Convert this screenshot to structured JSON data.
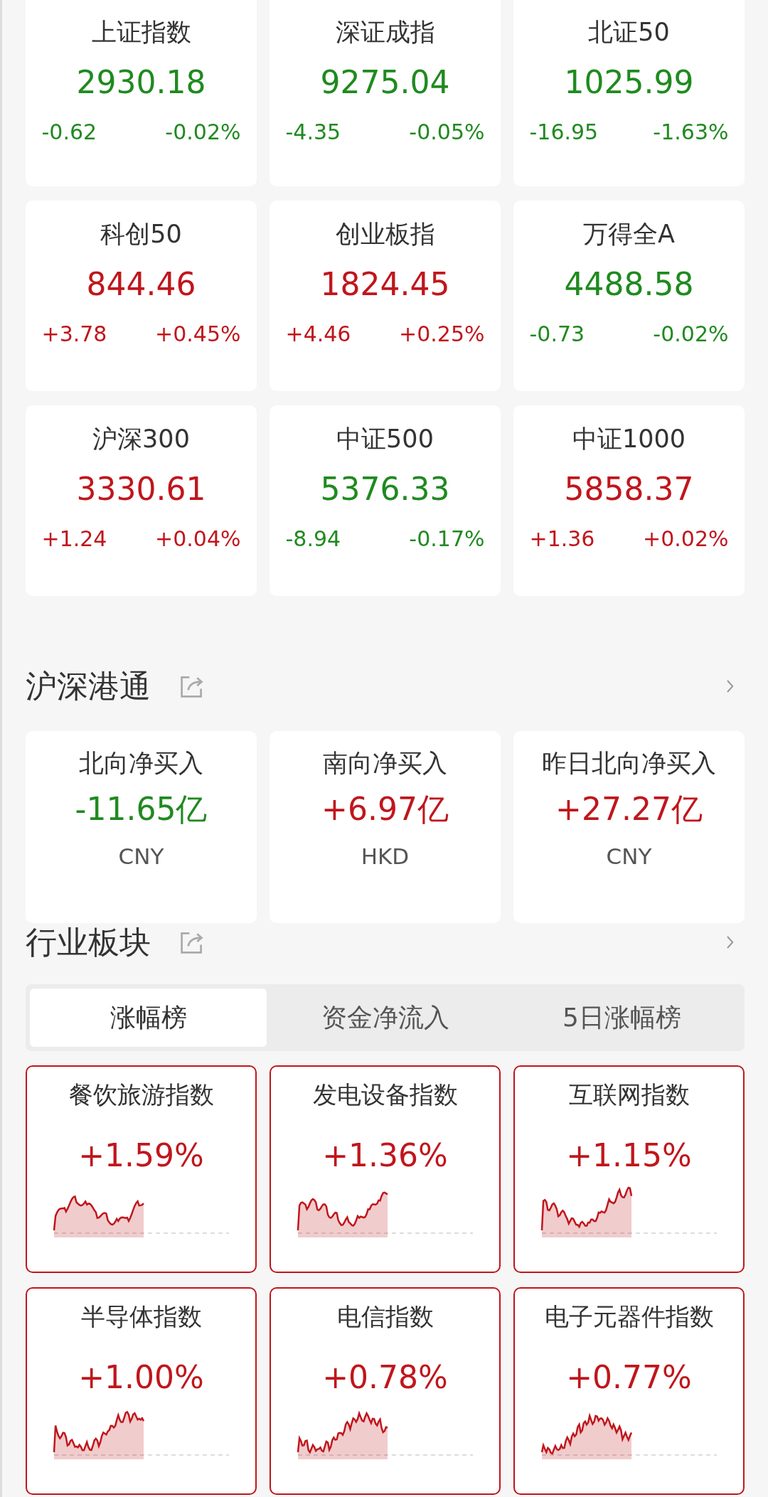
{
  "indices": [
    {
      "name": "上证指数",
      "value": "2930.18",
      "change": "-0.62",
      "percent": "-0.02%",
      "color": "#1f8a1f"
    },
    {
      "name": "深证成指",
      "value": "9275.04",
      "change": "-4.35",
      "percent": "-0.05%",
      "color": "#1f8a1f"
    },
    {
      "name": "北证50",
      "value": "1025.99",
      "change": "-16.95",
      "percent": "-1.63%",
      "color": "#1f8a1f"
    },
    {
      "name": "科创50",
      "value": "844.46",
      "change": "+3.78",
      "percent": "+0.45%",
      "color": "#c0161c"
    },
    {
      "name": "创业板指",
      "value": "1824.45",
      "change": "+4.46",
      "percent": "+0.25%",
      "color": "#c0161c"
    },
    {
      "name": "万得全A",
      "value": "4488.58",
      "change": "-0.73",
      "percent": "-0.02%",
      "color": "#1f8a1f"
    },
    {
      "name": "沪深300",
      "value": "3330.61",
      "change": "+1.24",
      "percent": "+0.04%",
      "color": "#c0161c"
    },
    {
      "name": "中证500",
      "value": "5376.33",
      "change": "-8.94",
      "percent": "-0.17%",
      "color": "#1f8a1f"
    },
    {
      "name": "中证1000",
      "value": "5858.37",
      "change": "+1.36",
      "percent": "+0.02%",
      "color": "#c0161c"
    }
  ],
  "connect": {
    "title": "沪深港通",
    "items": [
      {
        "name": "北向净买入",
        "value": "-11.65亿",
        "currency": "CNY",
        "color": "#1f8a1f"
      },
      {
        "name": "南向净买入",
        "value": "+6.97亿",
        "currency": "HKD",
        "color": "#c0161c"
      },
      {
        "name": "昨日北向净买入",
        "value": "+27.27亿",
        "currency": "CNY",
        "color": "#c0161c"
      }
    ]
  },
  "sectors": {
    "title": "行业板块",
    "tabs": [
      {
        "label": "涨幅榜",
        "selected": true
      },
      {
        "label": "资金净流入",
        "selected": false
      },
      {
        "label": "5日涨幅榜",
        "selected": false
      }
    ],
    "items": [
      {
        "name": "餐饮旅游指数",
        "percent": "+1.59%",
        "color": "#c0161c"
      },
      {
        "name": "发电设备指数",
        "percent": "+1.36%",
        "color": "#c0161c"
      },
      {
        "name": "互联网指数",
        "percent": "+1.15%",
        "color": "#c0161c"
      },
      {
        "name": "半导体指数",
        "percent": "+1.00%",
        "color": "#c0161c"
      },
      {
        "name": "电信指数",
        "percent": "+0.78%",
        "color": "#c0161c"
      },
      {
        "name": "电子元器件指数",
        "percent": "+0.77%",
        "color": "#c0161c"
      }
    ]
  }
}
